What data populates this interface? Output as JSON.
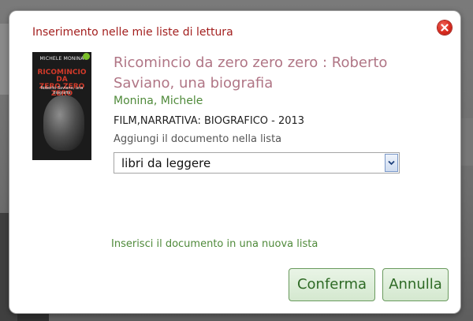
{
  "dialog": {
    "title": "Inserimento nelle mie liste di lettura",
    "close_icon": "close-icon"
  },
  "book": {
    "cover": {
      "author": "MICHELE MONINA",
      "title_lines": [
        "RICOMINCIO DA",
        "ZERO ZERO ZERO"
      ],
      "subtitle": "Roberto Saviano, una biografia"
    },
    "title": "Ricomincio da zero zero zero : Roberto Saviano, una biografia",
    "author": "Monina, Michele",
    "meta": "FILM,NARRATIVA: BIOGRAFICO - 2013"
  },
  "add_to_list": {
    "label": "Aggiungi il documento nella lista",
    "selected": "libri da leggere"
  },
  "new_list_link": "Inserisci il documento in una nuova lista",
  "buttons": {
    "confirm": "Conferma",
    "cancel": "Annulla"
  },
  "colors": {
    "title_red": "#a3201f",
    "book_title": "#b07585",
    "green": "#4f8a3a",
    "button_bg": "#d4e8cf"
  }
}
